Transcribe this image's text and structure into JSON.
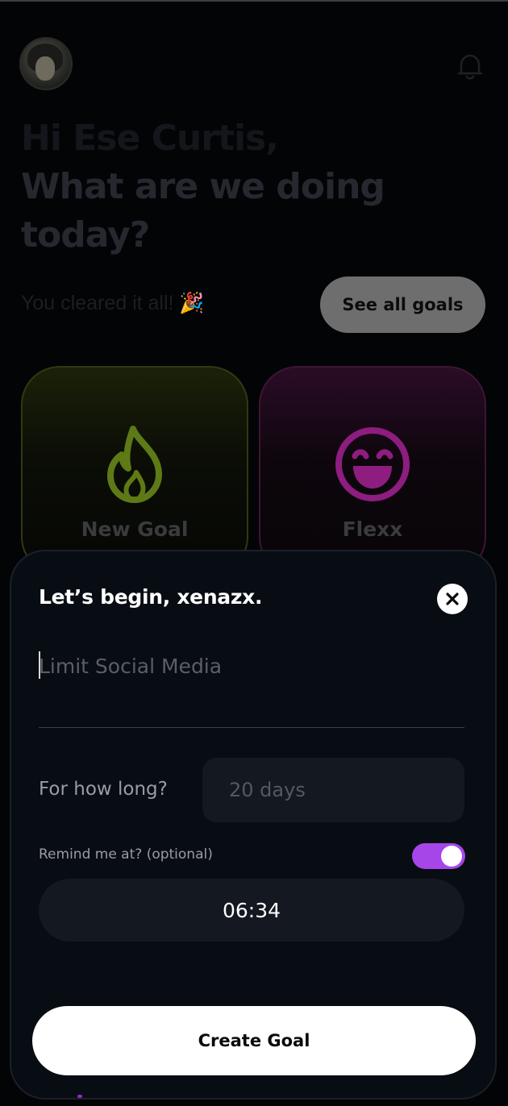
{
  "header": {
    "greeting_name": "Hi Ese Curtis,",
    "greeting_question": "What are we doing today?"
  },
  "status": {
    "cleared_text": "You cleared it all! 🎉",
    "see_all_label": "See all goals"
  },
  "cards": [
    {
      "label": "New Goal",
      "icon": "flame-icon",
      "color": "#5e7a17"
    },
    {
      "label": "Flexx",
      "icon": "laughing-face-icon",
      "color": "#8e1d80"
    }
  ],
  "sheet": {
    "title": "Let’s begin, xenazx.",
    "goal_placeholder": "Limit Social Media",
    "duration_label": "For how long?",
    "duration_placeholder": "20 days",
    "remind_label": "Remind me at? (optional)",
    "remind_enabled": true,
    "remind_time": "06:34",
    "create_label": "Create Goal"
  },
  "colors": {
    "accent_toggle": "#a646e8",
    "sheet_bg": "#080c13",
    "field_bg": "#141820"
  }
}
